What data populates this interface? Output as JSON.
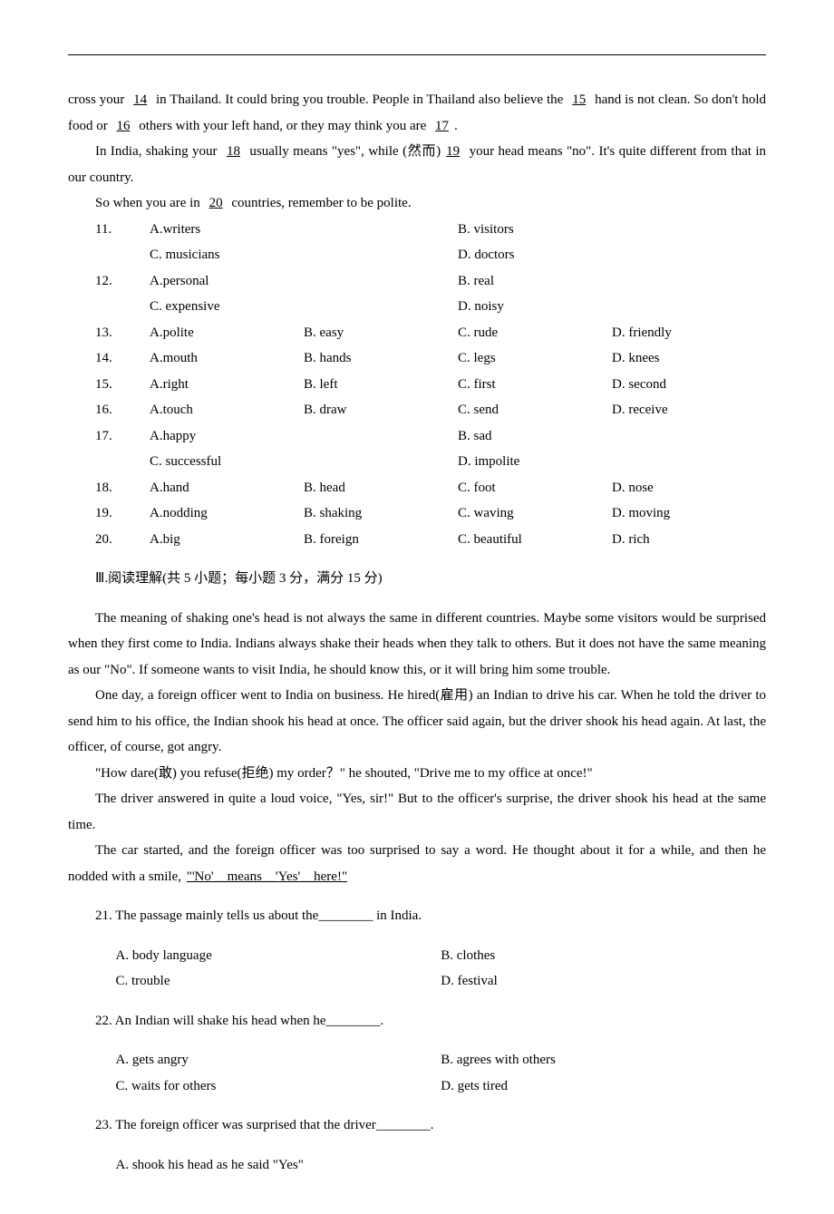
{
  "cloze_text": {
    "p1a": "cross your ",
    "p1_blank14": "14",
    "p1b": " in Thailand. It could bring you trouble. People in Thailand also believe the ",
    "p1_blank15": "15",
    "p1c": " hand is not clean. So don't hold food or ",
    "p1_blank16": "16",
    "p1d": " others with your left hand, or they may think you are ",
    "p1_blank17": "17",
    "p1e": ".",
    "p2a": "In India, shaking your ",
    "p2_blank18": "18",
    "p2b": " usually means \"yes\", while (然而)",
    "p2_blank19": "19",
    "p2c": " your head means \"no\". It's quite different from that in our country.",
    "p3a": "So when you are in ",
    "p3_blank20": "20",
    "p3b": " countries, remember to be polite."
  },
  "cloze_questions": [
    {
      "num": "11.",
      "cols": 2,
      "opts": [
        "A.writers",
        "B. visitors",
        "C. musicians",
        "D. doctors"
      ]
    },
    {
      "num": "12.",
      "cols": 2,
      "opts": [
        "A.personal",
        "B. real",
        "C. expensive",
        "D. noisy"
      ]
    },
    {
      "num": "13.",
      "cols": 4,
      "opts": [
        "A.polite",
        "B. easy",
        "C. rude",
        "D. friendly"
      ]
    },
    {
      "num": "14.",
      "cols": 4,
      "opts": [
        "A.mouth",
        "B. hands",
        "C. legs",
        "D. knees"
      ]
    },
    {
      "num": "15.",
      "cols": 4,
      "opts": [
        "A.right",
        "B. left",
        "C. first",
        "D. second"
      ]
    },
    {
      "num": "16.",
      "cols": 4,
      "opts": [
        "A.touch",
        "B. draw",
        "C. send",
        "D. receive"
      ]
    },
    {
      "num": "17.",
      "cols": 2,
      "opts": [
        "A.happy",
        "B. sad",
        "C. successful",
        "D. impolite"
      ]
    },
    {
      "num": "18.",
      "cols": 4,
      "opts": [
        "A.hand",
        "B. head",
        "C. foot",
        "D. nose"
      ]
    },
    {
      "num": "19.",
      "cols": 4,
      "opts": [
        "A.nodding",
        "B. shaking",
        "C. waving",
        "D. moving"
      ]
    },
    {
      "num": "20.",
      "cols": 4,
      "opts": [
        "A.big",
        "B. foreign",
        "C. beautiful",
        "D. rich"
      ]
    }
  ],
  "section3_title": "Ⅲ.阅读理解(共 5 小题；每小题 3 分，满分 15 分)",
  "passage": {
    "p1": "The meaning of shaking one's head is not always the same in different countries. Maybe some visitors would be surprised when they first come to India. Indians always shake their heads when they talk to others. But it does not have the same meaning as our \"No\". If someone wants to visit India, he should know this, or it will bring him some trouble.",
    "p2": "One day, a foreign officer went to India on business. He hired(雇用) an Indian to drive his car. When he told the driver to send him to his office, the Indian shook his head at once. The officer said again, but the driver shook his head again. At last, the officer, of course, got angry.",
    "p3": "\"How dare(敢) you refuse(拒绝) my order？\" he shouted, \"Drive me to my office at once!\"",
    "p4": "The driver answered in quite a loud voice, \"Yes, sir!\" But to the officer's surprise, the driver shook his head at the same time.",
    "p5a": "The car started, and the foreign officer was too surprised to say a word. He thought about it for a while, and then he nodded with a smile, ",
    "p5u": "\"'No'__means__'Yes'__here!\""
  },
  "reading_questions": [
    {
      "num": "21.",
      "stem": "The passage mainly tells us about the________ in India.",
      "cols": 2,
      "opts": [
        "A. body language",
        "B. clothes",
        "C. trouble",
        "D. festival"
      ]
    },
    {
      "num": "22.",
      "stem": "An Indian will shake his head when he________.",
      "cols": 2,
      "opts": [
        "A. gets angry",
        "B. agrees with others",
        "C. waits for others",
        "D. gets tired"
      ]
    },
    {
      "num": "23.",
      "stem": "The foreign officer was surprised that the driver________.",
      "cols": 1,
      "opts": [
        "A. shook his head as he said \"Yes\""
      ]
    }
  ]
}
